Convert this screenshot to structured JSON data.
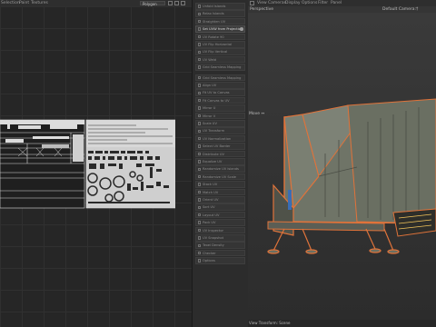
{
  "uv_editor": {
    "menu": [
      "Selection",
      "Paint",
      "Textures"
    ],
    "mode_select": "Polygon"
  },
  "tool_panel": {
    "items": [
      {
        "label": "Unfold Islands",
        "active": false
      },
      {
        "label": "Relax Islands",
        "active": false
      },
      {
        "label": "Straighten UV",
        "active": false
      },
      {
        "label": "Set UVW from Projection",
        "active": true
      },
      {
        "label": "UV Rotate 90",
        "active": false
      },
      {
        "label": "UV Flip Horizontal",
        "active": false
      },
      {
        "label": "UV Flip Vertical",
        "active": false
      },
      {
        "label": "UV Weld",
        "active": false
      },
      {
        "label": "Grid Seamless Mapping",
        "active": false
      },
      {
        "label": "Grid Seamless Mapping",
        "active": false
      },
      {
        "label": "Align UV",
        "active": false
      },
      {
        "label": "Fit UV to Canvas",
        "active": false
      },
      {
        "label": "Fit Canvas to UV",
        "active": false
      },
      {
        "label": "Mirror U",
        "active": false
      },
      {
        "label": "Mirror V",
        "active": false
      },
      {
        "label": "Scale UV",
        "active": false
      },
      {
        "label": "UV Transform",
        "active": false
      },
      {
        "label": "UV Normalization",
        "active": false
      },
      {
        "label": "Select UV Border",
        "active": false
      },
      {
        "label": "Distribute UV",
        "active": false
      },
      {
        "label": "Equalize UV",
        "active": false
      },
      {
        "label": "Randomize UV Islands",
        "active": false
      },
      {
        "label": "Randomize UV Scale",
        "active": false
      },
      {
        "label": "Stack UV",
        "active": false
      },
      {
        "label": "Match UV",
        "active": false
      },
      {
        "label": "Orient UV",
        "active": false
      },
      {
        "label": "Sort UV",
        "active": false
      },
      {
        "label": "Layout UV",
        "active": false
      },
      {
        "label": "Pack UV",
        "active": false
      },
      {
        "label": "UV Inspector",
        "active": false
      },
      {
        "label": "UV Snapshot",
        "active": false
      },
      {
        "label": "Texel Density",
        "active": false
      },
      {
        "label": "Checker",
        "active": false
      },
      {
        "label": "Options",
        "active": false
      }
    ]
  },
  "viewport": {
    "menu": [
      "View",
      "Cameras",
      "Display",
      "Options",
      "Filter",
      "Panel"
    ],
    "camera_label": "Perspective",
    "default_camera": "Default Camera:†",
    "move_label": "Move ↔",
    "status": "View Transform: Scene"
  },
  "colors": {
    "model_fill": "#6f7467",
    "model_outline": "#e0733a",
    "active_tool": "#dcdcdc"
  }
}
